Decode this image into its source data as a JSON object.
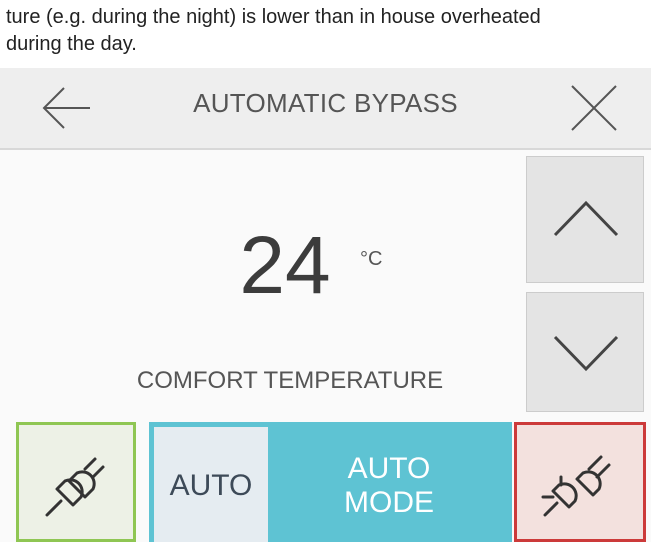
{
  "intro": {
    "line1": "ture (e.g. during the night) is lower than in house overheated",
    "line2": "during the day."
  },
  "header": {
    "title": "AUTOMATIC BYPASS",
    "back_icon": "arrow-left-icon",
    "close_icon": "close-icon"
  },
  "temperature": {
    "value": "24",
    "unit": "°C",
    "label": "COMFORT TEMPERATURE"
  },
  "controls": {
    "up_icon": "chevron-up-icon",
    "down_icon": "chevron-down-icon",
    "left_icon": "plug-connected-icon",
    "right_icon": "plug-disconnected-icon"
  },
  "mode": {
    "toggle_label": "AUTO",
    "line1": "AUTO",
    "line2": "MODE"
  },
  "colors": {
    "accent": "#5ec3d3",
    "connected_border": "#8fc653",
    "disconnected_border": "#cc3a3a"
  }
}
